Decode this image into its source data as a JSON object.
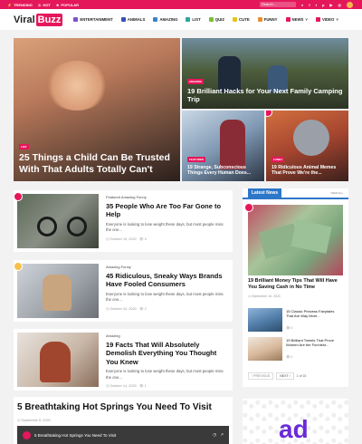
{
  "topbar": {
    "nav": [
      "TRENDING",
      "HOT",
      "POPULAR"
    ],
    "search_placeholder": "Search..."
  },
  "logo": {
    "part1": "Viral",
    "part2": "Buzz"
  },
  "menu": [
    {
      "label": "ENTERTAINMENT",
      "color": "#7a52c9"
    },
    {
      "label": "ANIMALS",
      "color": "#3a4fb7"
    },
    {
      "label": "AMAZING",
      "color": "#3a83c9"
    },
    {
      "label": "LIST",
      "color": "#2ea59d"
    },
    {
      "label": "QUIZ",
      "color": "#7cbd34"
    },
    {
      "label": "CUTE",
      "color": "#e1c61f"
    },
    {
      "label": "FUNNY",
      "color": "#e98d2f"
    },
    {
      "label": "NEWS",
      "color": "#e5175b"
    },
    {
      "label": "VIDEO",
      "color": "#e5175b"
    }
  ],
  "hero": {
    "main": {
      "tag": "LIST",
      "title": "25 Things a Child Can Be Trusted With That Adults Totally Can't"
    },
    "top_right": {
      "tag": "AMAZING",
      "title": "19 Brilliant Hacks for Your Next Family Camping Trip"
    },
    "bottom_mid": {
      "tag": "FEATURED",
      "title": "19 Strange, Subconscious Things Every Human Does..."
    },
    "bottom_right": {
      "tag": "FUNNY",
      "title": "19 Ridiculous Animal Memes That Prove We're the..."
    }
  },
  "posts": [
    {
      "tags": "Featured  Amazing  Funny",
      "title": "35 People Who Are Too Far Gone to Help",
      "excerpt": "Everyone is looking to lose weight these days, but most people miss the one...",
      "date": "October 15, 2020",
      "views": "0"
    },
    {
      "tags": "Amazing  Funny",
      "title": "45 Ridiculous, Sneaky Ways Brands Have Fooled Consumers",
      "excerpt": "Everyone is looking to lose weight these days, but most people miss the one...",
      "date": "October 15, 2020",
      "views": "2"
    },
    {
      "tags": "Amazing",
      "title": "19 Facts That Will Absolutely Demolish Everything You Thought You Knew",
      "excerpt": "Everyone is looking to lose weight these days, but most people miss the one...",
      "date": "October 14, 2020",
      "views": "1"
    }
  ],
  "video_post": {
    "title": "5 Breathtaking Hot Springs You Need To Visit",
    "date": "September 8, 2020",
    "embed_title": "5 Breathtaking Hot Springs You Need To Visit"
  },
  "sidebar": {
    "title": "Latest News",
    "view_all": "VIEW ALL",
    "feature": {
      "title": "19 Brilliant Money Tips That Will Have You Saving Cash in No Time",
      "date": "September 16, 2020"
    },
    "items": [
      {
        "title": "15 Classic Princess Fairytales That Are Way More...",
        "views": "0"
      },
      {
        "title": "19 Brilliant Tweets That Prove Women Are the Funniest...",
        "views": "0"
      }
    ],
    "pager": {
      "prev": "PREVIOUS",
      "next": "NEXT",
      "count": "1 of 15"
    }
  },
  "ad": {
    "text": "ad"
  }
}
